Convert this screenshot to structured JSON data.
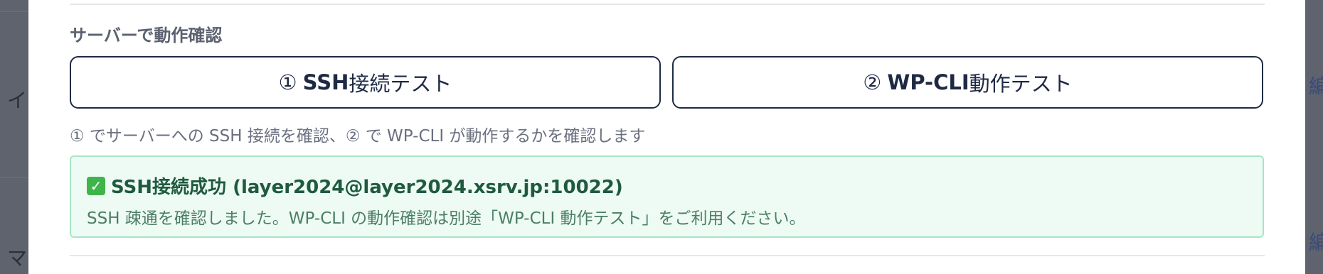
{
  "background": {
    "left_chars": [
      "イ",
      "マ"
    ],
    "right_chars": [
      "編",
      "編"
    ]
  },
  "section": {
    "title": "サーバーで動作確認"
  },
  "buttons": {
    "ssh": {
      "number": "①",
      "label": "SSH接続テスト",
      "strong": "SSH",
      "rest": "接続テスト"
    },
    "wpcli": {
      "number": "②",
      "label": "WP-CLI動作テスト",
      "strong": "WP-CLI",
      "rest": "動作テスト"
    }
  },
  "hint": "① でサーバーへの SSH 接続を確認、② で WP-CLI が動作するかを確認します",
  "alert": {
    "icon": "check-icon",
    "title": "SSH接続成功 (layer2024@layer2024.xsrv.jp:10022)",
    "message": "SSH 疎通を確認しました。WP-CLI の動作確認は別途「WP-CLI 動作テスト」をご利用ください。"
  },
  "colors": {
    "button_border": "#1f2a44",
    "alert_bg": "#edfbf4",
    "alert_border": "#a6e6c6",
    "alert_title": "#1f5a3e",
    "check_green": "#3fb44a"
  }
}
